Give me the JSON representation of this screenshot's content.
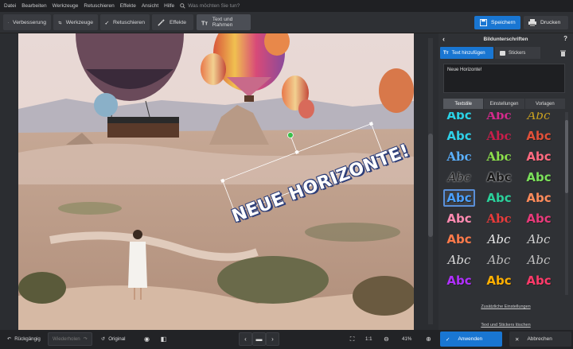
{
  "menu": [
    "Datei",
    "Bearbeiten",
    "Werkzeuge",
    "Retuschieren",
    "Effekte",
    "Ansicht",
    "Hilfe"
  ],
  "search_placeholder": "Was möchten Sie tun?",
  "toolbar": {
    "verbesserung": "Verbesserung",
    "werkzeuge": "Werkzeuge",
    "retuschieren": "Retuschieren",
    "effekte": "Effekte",
    "text_und_rahmen": "Text und Rahmen",
    "speichern": "Speichern",
    "drucken": "Drucken"
  },
  "overlay_text": "NEUE HORIZONTE!",
  "panel": {
    "title": "Bildunterschriften",
    "add_text": "Text hinzufügen",
    "stickers": "Stickers",
    "text_value": "Neue Horizonte!",
    "tabs": [
      "Textstile",
      "Einstellungen",
      "Vorlagen"
    ],
    "sample": "Abc",
    "more_settings": "Zusätzliche Einstellungen",
    "clear": "Text und Stickers löschen"
  },
  "bottombar": {
    "undo": "Rückgängig",
    "redo": "Wiederholen",
    "original": "Original",
    "ratio": "1:1",
    "zoom": "41%",
    "apply": "Anwenden",
    "cancel": "Abbrechen"
  },
  "styles": [
    {
      "color": "#2ad2e6",
      "style": "sans"
    },
    {
      "color": "#d42a8c",
      "style": "serif"
    },
    {
      "color": "#c8a020",
      "style": "script"
    },
    {
      "color": "#2fd0e8",
      "style": "sans"
    },
    {
      "color": "#c81e4a",
      "style": "serif"
    },
    {
      "color": "#e0503a",
      "style": "bold"
    },
    {
      "color": "#5ab0ff",
      "style": "serif"
    },
    {
      "color": "#8ce04a",
      "style": "serif"
    },
    {
      "color": "#ff6a80",
      "style": "bold"
    },
    {
      "color": "#1a1a1a",
      "style": "script"
    },
    {
      "color": "#1a1a1a",
      "style": "bold"
    },
    {
      "color": "#7ae05a",
      "style": "bold"
    },
    {
      "color": "#4aa0ff",
      "style": "bold"
    },
    {
      "color": "#2ad09a",
      "style": "sans"
    },
    {
      "color": "#ff8a5a",
      "style": "sans"
    },
    {
      "color": "#ff8ab0",
      "style": "sans"
    },
    {
      "color": "#e83a3a",
      "style": "serif"
    },
    {
      "color": "#e83a7a",
      "style": "bold"
    },
    {
      "color": "#ff7a4a",
      "style": "sans"
    },
    {
      "color": "#e8e8e8",
      "style": "script"
    },
    {
      "color": "#d0d0d0",
      "style": "script"
    },
    {
      "color": "#dadada",
      "style": "script"
    },
    {
      "color": "#bcbcbc",
      "style": "script"
    },
    {
      "color": "#c0c0c0",
      "style": "script"
    },
    {
      "color": "#b030ff",
      "style": "bold"
    },
    {
      "color": "#ffb000",
      "style": "bold"
    },
    {
      "color": "#ff3a6a",
      "style": "bold"
    }
  ]
}
